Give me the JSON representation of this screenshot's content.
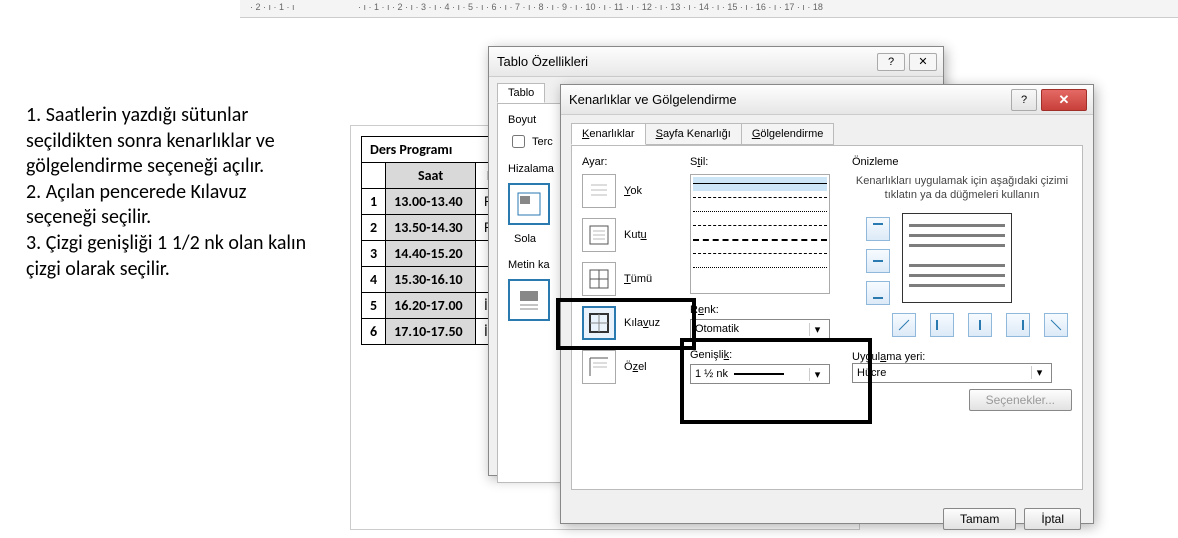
{
  "ruler": {
    "ticks": [
      "2",
      "1",
      "",
      "1",
      "2",
      "3",
      "4",
      "5",
      "6",
      "7",
      "8",
      "9",
      "10",
      "11",
      "12",
      "13",
      "14",
      "15",
      "16",
      "17",
      "18"
    ]
  },
  "instructions": {
    "item1": "1. Saatlerin yazdığı sütunlar seçildikten sonra kenarlıklar ve gölgelendirme seçeneği açılır.",
    "item2": "2. Açılan pencerede Kılavuz seçeneği seçilir.",
    "item3": "3. Çizgi genişliği 1 1/2 nk olan kalın çizgi olarak seçilir."
  },
  "doc_table": {
    "title": "Ders Programı",
    "col_saat": "Saat",
    "col_other": "P",
    "rows": [
      {
        "n": "1",
        "saat": "13.00-13.40",
        "c": "Fe"
      },
      {
        "n": "2",
        "saat": "13.50-14.30",
        "c": "Fe"
      },
      {
        "n": "3",
        "saat": "14.40-15.20",
        "c": ""
      },
      {
        "n": "4",
        "saat": "15.30-16.10",
        "c": ""
      },
      {
        "n": "5",
        "saat": "16.20-17.00",
        "c": "İ"
      },
      {
        "n": "6",
        "saat": "17.10-17.50",
        "c": "İ"
      }
    ]
  },
  "dlg_props": {
    "title": "Tablo Özellikleri",
    "help": "?",
    "close": "✕",
    "tab": "Tablo",
    "boyut": "Boyut",
    "terc_chk": "Terc",
    "hizalama": "Hizalama",
    "sola": "Sola",
    "metin": "Metin ka"
  },
  "dlg_borders": {
    "title": "Kenarlıklar ve Gölgelendirme",
    "help": "?",
    "close": "✕",
    "tabs": {
      "kenarliklar": "Kenarlıklar",
      "sayfa": "Sayfa Kenarlığı",
      "golge": "Gölgelendirme"
    },
    "ayar_label": "Ayar:",
    "ayar": {
      "yok": "Yok",
      "kutu": "Kutu",
      "tumu": "Tümü",
      "kilavuz": "Kılavuz",
      "ozel": "Özel"
    },
    "stil_label": "Stil:",
    "renk_label": "Renk:",
    "renk_val": "Otomatik",
    "genislik_label": "Genişlik:",
    "genislik_val": "1 ½ nk",
    "preview_label": "Önizleme",
    "preview_desc": "Kenarlıkları uygulamak için aşağıdaki çizimi tıklatın ya da düğmeleri kullanın",
    "apply_label": "Uygulama yeri:",
    "apply_val": "Hücre",
    "seçenekler": "Seçenekler...",
    "tamam": "Tamam",
    "iptal": "İptal"
  }
}
